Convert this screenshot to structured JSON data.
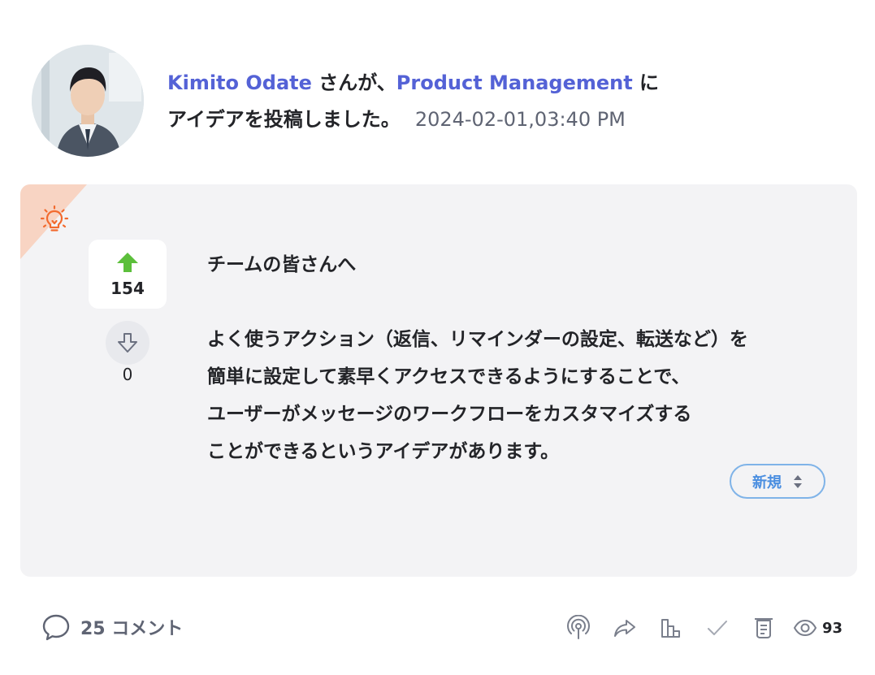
{
  "post": {
    "author": "Kimito Odate",
    "connector": "さんが、",
    "group": "Product Management",
    "group_suffix": " に",
    "action": "アイデアを投稿しました。",
    "timestamp": "2024-02-01,03:40 PM"
  },
  "card": {
    "icon": "lightbulb-icon",
    "accent_color": "#f26a2e",
    "votes": {
      "up_count": "154",
      "down_count": "0"
    },
    "greeting": "チームの皆さんへ",
    "lines": [
      "よく使うアクション（返信、リマインダーの設定、転送など）を",
      "簡単に設定して素早くアクセスできるようにすることで、",
      "ユーザーがメッセージのワークフローをカスタマイズする",
      "ことができるというアイデアがあります。"
    ],
    "status_label": "新規"
  },
  "footer": {
    "comments_label": "25 コメント",
    "views_count": "93",
    "actions": [
      "podcast-icon",
      "share-icon",
      "bar-chart-icon",
      "check-icon",
      "notes-icon"
    ]
  }
}
